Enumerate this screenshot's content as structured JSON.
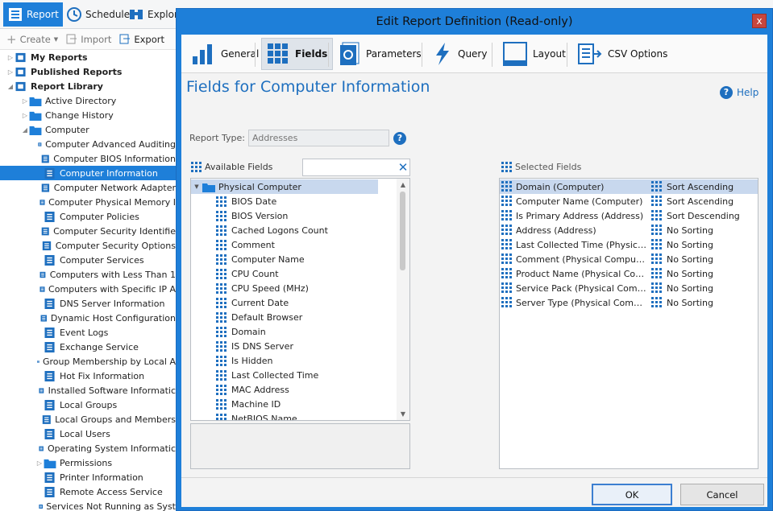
{
  "main": {
    "tabs": [
      {
        "label": "Report",
        "icon": "report-icon"
      },
      {
        "label": "Schedule",
        "icon": "schedule-icon"
      },
      {
        "label": "Explore",
        "icon": "binoculars-icon"
      }
    ],
    "actions": [
      {
        "label": "Create",
        "icon": "plus-icon"
      },
      {
        "label": "Import",
        "icon": "import-icon"
      },
      {
        "label": "Export",
        "icon": "export-icon"
      }
    ],
    "tree": [
      {
        "label": "My Reports",
        "level": 0,
        "bold": true,
        "icon": "user-icon"
      },
      {
        "label": "Published Reports",
        "level": 0,
        "bold": true,
        "icon": "stack-icon"
      },
      {
        "label": "Report Library",
        "level": 0,
        "bold": true,
        "icon": "library-icon",
        "expanded": true
      },
      {
        "label": "Active Directory",
        "level": 1,
        "icon": "folder-icon"
      },
      {
        "label": "Change History",
        "level": 1,
        "icon": "folder-icon"
      },
      {
        "label": "Computer",
        "level": 1,
        "icon": "folder-icon",
        "expanded": true
      },
      {
        "label": "Computer Advanced Auditing",
        "level": 2,
        "icon": "report-doc-icon"
      },
      {
        "label": "Computer BIOS Information",
        "level": 2,
        "icon": "report-doc-icon"
      },
      {
        "label": "Computer Information",
        "level": 2,
        "icon": "report-doc-icon",
        "selected": true
      },
      {
        "label": "Computer Network Adapter",
        "level": 2,
        "icon": "report-doc-icon"
      },
      {
        "label": "Computer Physical Memory I",
        "level": 2,
        "icon": "report-doc-icon"
      },
      {
        "label": "Computer Policies",
        "level": 2,
        "icon": "report-doc-icon"
      },
      {
        "label": "Computer Security Identifie",
        "level": 2,
        "icon": "report-doc-icon"
      },
      {
        "label": "Computer Security Options",
        "level": 2,
        "icon": "report-doc-icon"
      },
      {
        "label": "Computer Services",
        "level": 2,
        "icon": "report-doc-icon"
      },
      {
        "label": "Computers with Less Than 1",
        "level": 2,
        "icon": "report-doc-icon"
      },
      {
        "label": "Computers with Specific IP A",
        "level": 2,
        "icon": "report-doc-icon"
      },
      {
        "label": "DNS Server Information",
        "level": 2,
        "icon": "report-doc-icon"
      },
      {
        "label": "Dynamic Host Configuration",
        "level": 2,
        "icon": "report-doc-icon"
      },
      {
        "label": "Event Logs",
        "level": 2,
        "icon": "report-doc-icon"
      },
      {
        "label": "Exchange Service",
        "level": 2,
        "icon": "report-doc-icon"
      },
      {
        "label": "Group Membership by Local A",
        "level": 2,
        "icon": "report-doc-icon"
      },
      {
        "label": "Hot Fix Information",
        "level": 2,
        "icon": "report-doc-icon"
      },
      {
        "label": "Installed Software Informatic",
        "level": 2,
        "icon": "report-doc-icon"
      },
      {
        "label": "Local Groups",
        "level": 2,
        "icon": "report-doc-icon"
      },
      {
        "label": "Local Groups and Members",
        "level": 2,
        "icon": "report-doc-icon"
      },
      {
        "label": "Local Users",
        "level": 2,
        "icon": "report-doc-icon"
      },
      {
        "label": "Operating System Informatic",
        "level": 2,
        "icon": "report-doc-icon"
      },
      {
        "label": "Permissions",
        "level": 2,
        "icon": "folder-icon"
      },
      {
        "label": "Printer Information",
        "level": 2,
        "icon": "report-doc-icon"
      },
      {
        "label": "Remote Access Service",
        "level": 2,
        "icon": "report-doc-icon"
      },
      {
        "label": "Services Not Running as Syst",
        "level": 2,
        "icon": "report-doc-icon"
      }
    ]
  },
  "dialog": {
    "title": "Edit Report Definition (Read-only)",
    "close_glyph": "x",
    "tabs": [
      {
        "label": "General",
        "icon": "bar-chart-icon"
      },
      {
        "label": "Fields",
        "icon": "grid-icon",
        "active": true
      },
      {
        "label": "Parameters",
        "icon": "parameters-icon"
      },
      {
        "label": "Query",
        "icon": "lightning-icon"
      },
      {
        "label": "Layout",
        "icon": "layout-icon"
      },
      {
        "label": "CSV Options",
        "icon": "csv-icon"
      }
    ],
    "page_title": "Fields for Computer Information",
    "help_label": "Help",
    "report_type_label": "Report Type:",
    "report_type_placeholder": "Addresses",
    "available_fields_label": "Available Fields",
    "search_value": "",
    "selected_fields_label": "Selected Fields",
    "available_root": "Physical Computer",
    "available_fields": [
      "BIOS Date",
      "BIOS Version",
      "Cached Logons Count",
      "Comment",
      "Computer Name",
      "CPU Count",
      "CPU Speed (MHz)",
      "Current Date",
      "Default Browser",
      "Domain",
      "IS DNS Server",
      "Is Hidden",
      "Last Collected Time",
      "MAC Address",
      "Machine ID",
      "NetBIOS Name"
    ],
    "selected_fields": [
      {
        "field": "Domain (Computer)",
        "sort": "Sort Ascending",
        "selected": true
      },
      {
        "field": "Computer Name (Computer)",
        "sort": "Sort Ascending"
      },
      {
        "field": "Is Primary Address (Address)",
        "sort": "Sort Descending"
      },
      {
        "field": "Address (Address)",
        "sort": "No Sorting"
      },
      {
        "field": "Last Collected Time (Physical ...",
        "sort": "No Sorting"
      },
      {
        "field": "Comment (Physical Computer)",
        "sort": "No Sorting"
      },
      {
        "field": "Product Name (Physical Comp...",
        "sort": "No Sorting"
      },
      {
        "field": "Service Pack (Physical Compu...",
        "sort": "No Sorting"
      },
      {
        "field": "Server Type (Physical Comput...",
        "sort": "No Sorting"
      }
    ],
    "ok_label": "OK",
    "cancel_label": "Cancel"
  },
  "colors": {
    "accent": "#1e7fd9",
    "title_blue": "#1e6fbf",
    "selection": "#c8d8ee"
  }
}
